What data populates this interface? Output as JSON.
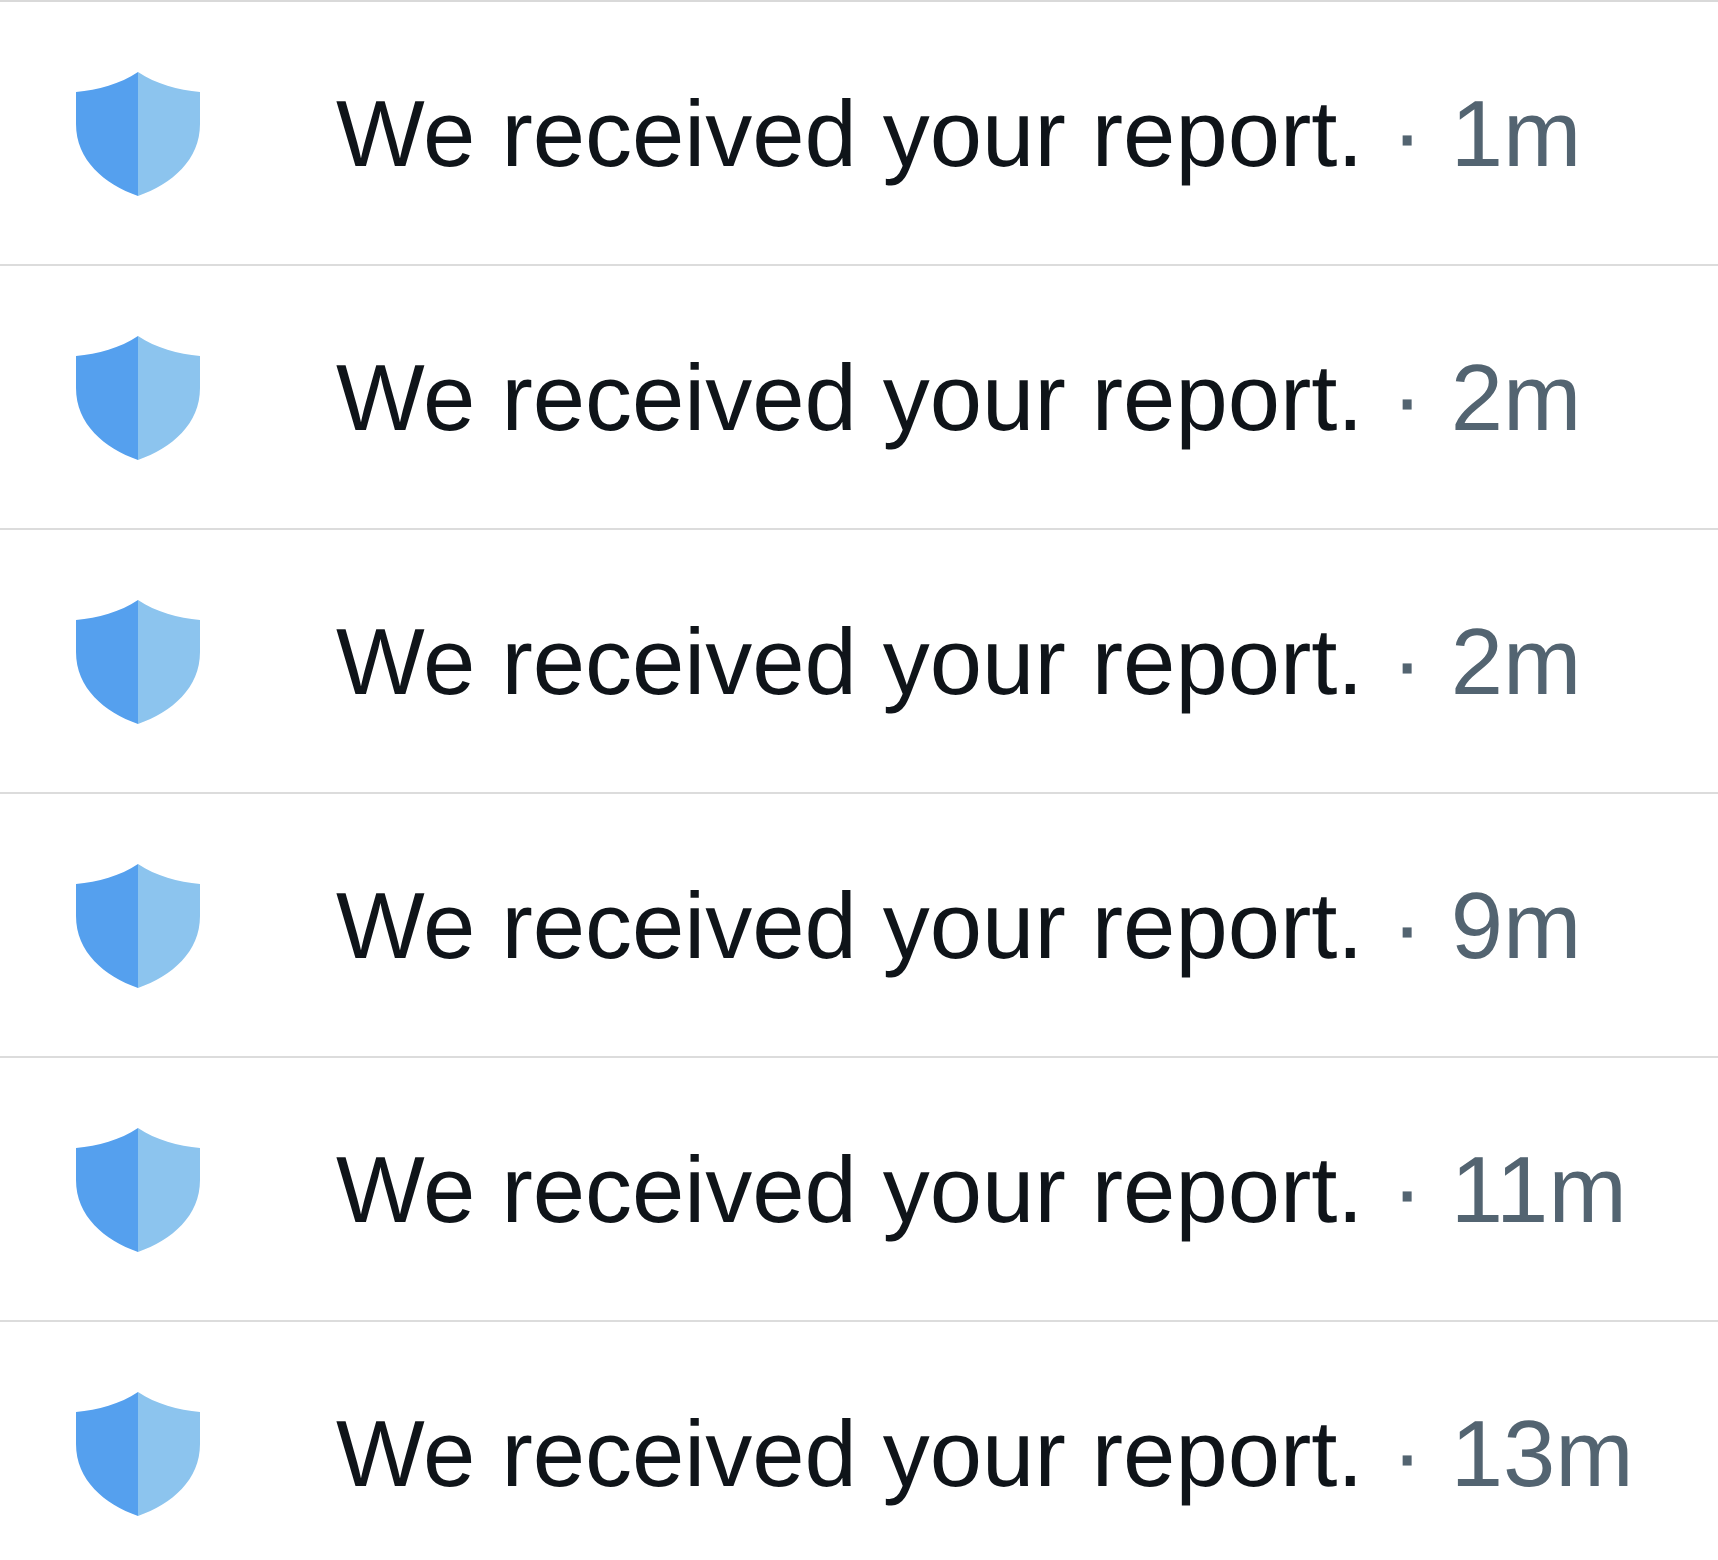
{
  "notifications": [
    {
      "message": "We received your report.",
      "separator": "·",
      "time": "1m"
    },
    {
      "message": "We received your report.",
      "separator": "·",
      "time": "2m"
    },
    {
      "message": "We received your report.",
      "separator": "·",
      "time": "2m"
    },
    {
      "message": "We received your report.",
      "separator": "·",
      "time": "9m"
    },
    {
      "message": "We received your report.",
      "separator": "·",
      "time": "11m"
    },
    {
      "message": "We received your report.",
      "separator": "·",
      "time": "13m"
    }
  ]
}
